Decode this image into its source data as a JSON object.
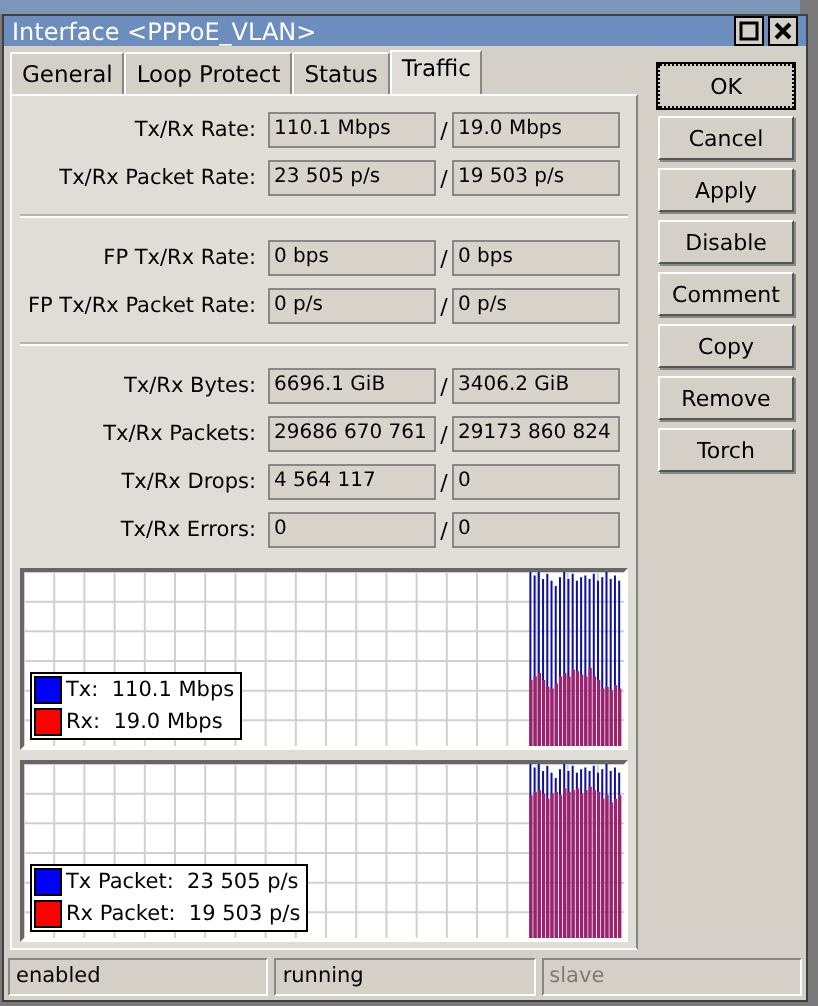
{
  "window": {
    "title": "Interface <PPPoE_VLAN>"
  },
  "tabs": [
    {
      "label": "General",
      "selected": false
    },
    {
      "label": "Loop Protect",
      "selected": false
    },
    {
      "label": "Status",
      "selected": false
    },
    {
      "label": "Traffic",
      "selected": true
    }
  ],
  "groups": [
    {
      "rows": [
        {
          "label": "Tx/Rx Rate:",
          "tx": "110.1 Mbps",
          "separator": "/",
          "rx": "19.0 Mbps"
        },
        {
          "label": "Tx/Rx Packet Rate:",
          "tx": "23 505 p/s",
          "separator": "/",
          "rx": "19 503 p/s"
        }
      ]
    },
    {
      "rows": [
        {
          "label": "FP Tx/Rx Rate:",
          "tx": "0 bps",
          "separator": "/",
          "rx": "0 bps"
        },
        {
          "label": "FP Tx/Rx Packet Rate:",
          "tx": "0 p/s",
          "separator": "/",
          "rx": "0 p/s"
        }
      ]
    },
    {
      "rows": [
        {
          "label": "Tx/Rx Bytes:",
          "tx": "6696.1 GiB",
          "separator": "/",
          "rx": "3406.2 GiB"
        },
        {
          "label": "Tx/Rx Packets:",
          "tx": "29686 670 761",
          "separator": "/",
          "rx": "29173 860 824"
        },
        {
          "label": "Tx/Rx Drops:",
          "tx": "4 564 117",
          "separator": "/",
          "rx": "0"
        },
        {
          "label": "Tx/Rx Errors:",
          "tx": "0",
          "separator": "/",
          "rx": "0"
        }
      ]
    }
  ],
  "graphs": [
    {
      "legend": [
        {
          "label": "Tx:  110.1 Mbps",
          "color": "#0000ff"
        },
        {
          "label": "Rx:  19.0 Mbps",
          "color": "#ff0000"
        }
      ]
    },
    {
      "legend": [
        {
          "label": "Tx Packet:  23 505 p/s",
          "color": "#0000ff"
        },
        {
          "label": "Rx Packet:  19 503 p/s",
          "color": "#ff0000"
        }
      ]
    }
  ],
  "buttons": [
    {
      "label": "OK",
      "default": true
    },
    {
      "label": "Cancel",
      "default": false
    },
    {
      "label": "Apply",
      "default": false
    },
    {
      "label": "Disable",
      "default": false
    },
    {
      "label": "Comment",
      "default": false
    },
    {
      "label": "Copy",
      "default": false
    },
    {
      "label": "Remove",
      "default": false
    },
    {
      "label": "Torch",
      "default": false
    }
  ],
  "status_bar": [
    {
      "text": "enabled",
      "disabled": false
    },
    {
      "text": "running",
      "disabled": false
    },
    {
      "text": "slave",
      "disabled": true
    }
  ]
}
